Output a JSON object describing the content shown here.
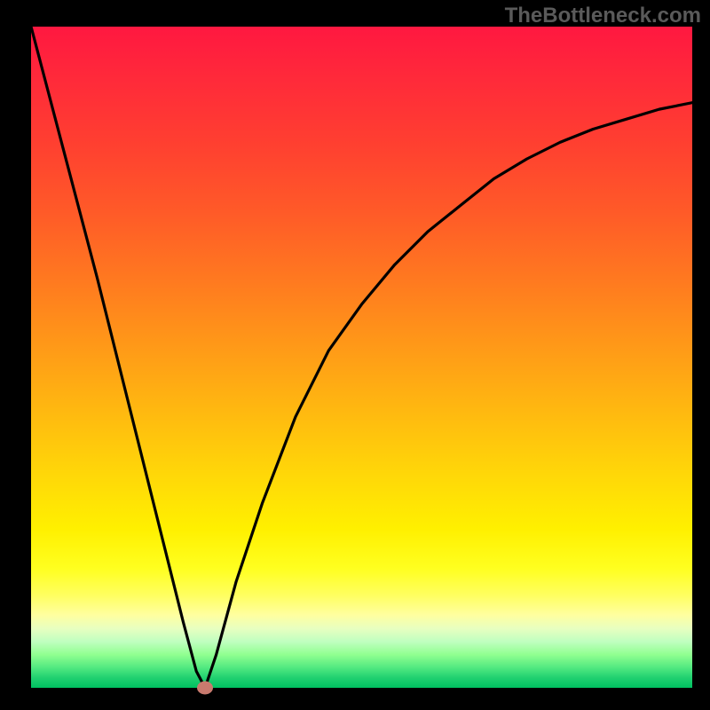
{
  "watermark": "TheBottleneck.com",
  "chart_data": {
    "type": "line",
    "title": "",
    "xlabel": "",
    "ylabel": "",
    "xlim": [
      0,
      1
    ],
    "ylim": [
      0,
      1
    ],
    "series": [
      {
        "name": "bottleneck-curve",
        "x": [
          0.0,
          0.05,
          0.1,
          0.15,
          0.2,
          0.23,
          0.25,
          0.2632,
          0.28,
          0.31,
          0.35,
          0.4,
          0.45,
          0.5,
          0.55,
          0.6,
          0.65,
          0.7,
          0.75,
          0.8,
          0.85,
          0.9,
          0.95,
          1.0
        ],
        "y": [
          1.0,
          0.81,
          0.62,
          0.42,
          0.22,
          0.1,
          0.025,
          0.0,
          0.05,
          0.16,
          0.28,
          0.41,
          0.51,
          0.58,
          0.64,
          0.69,
          0.73,
          0.77,
          0.8,
          0.825,
          0.845,
          0.86,
          0.875,
          0.885
        ]
      }
    ],
    "marker": {
      "x": 0.2632,
      "y": 0.0
    },
    "background_gradient": {
      "top": "#ff1840",
      "mid": "#ffe000",
      "bottom": "#00c060"
    },
    "frame_color": "#000000"
  }
}
